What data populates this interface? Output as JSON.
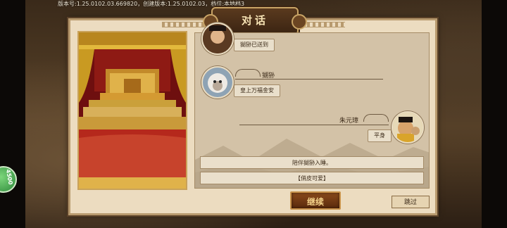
{
  "status_bar": {
    "version_line": "版本号:1.25.0102.03.669820，创建版本:1.25.0102.03，档位:本地档3"
  },
  "side_badge": {
    "text": "4500"
  },
  "dialog": {
    "title": "对话"
  },
  "messages": [
    {
      "speaker": "",
      "text": "猢狲已送到",
      "side": "left",
      "avatar_icon": "official-portrait-icon"
    },
    {
      "speaker": "猢狲",
      "text": "皇上万福金安",
      "side": "left",
      "avatar_icon": "monkey-portrait-icon"
    },
    {
      "speaker": "朱元璋",
      "text": "平身",
      "side": "right",
      "avatar_icon": "emperor-portrait-icon"
    }
  ],
  "choices": [
    {
      "label": "陪伴猢狲入睡。"
    },
    {
      "label": "【俏皮可爱】"
    }
  ],
  "buttons": {
    "continue": "继续",
    "skip": "跳过"
  },
  "colors": {
    "panel": "#ecdcc0",
    "chat_bg": "#d3c2a7",
    "accent_gold": "#c8a466",
    "continue_btn": "#7a3c14"
  }
}
